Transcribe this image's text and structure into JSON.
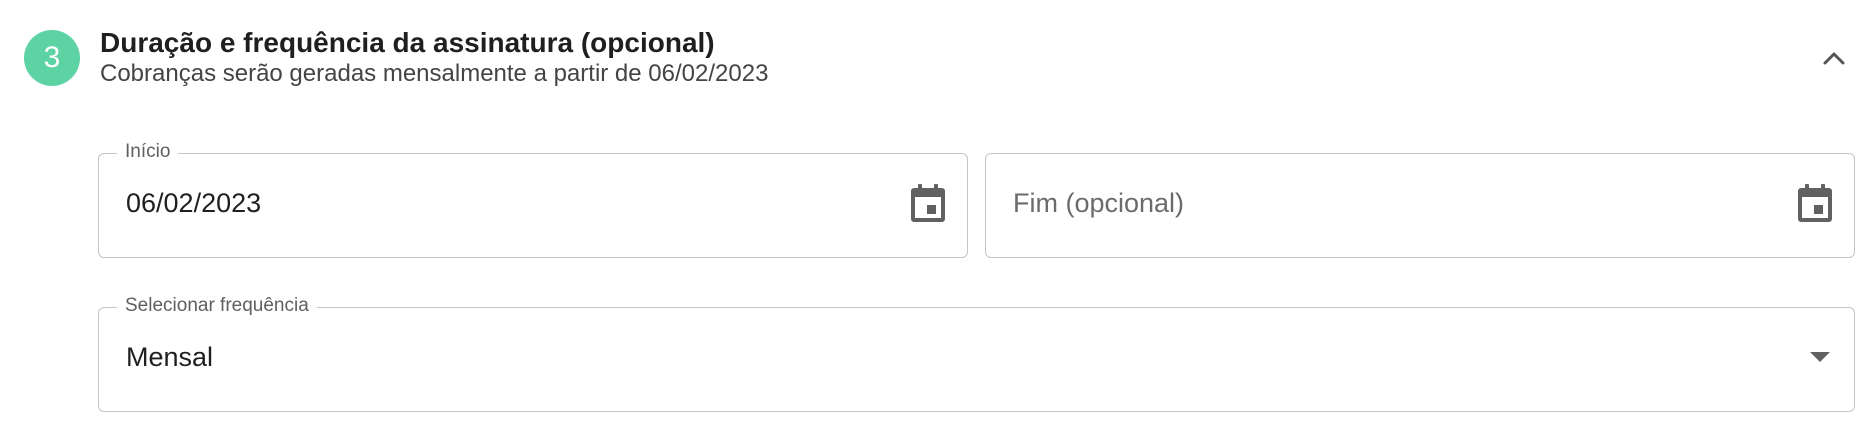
{
  "step": {
    "number": "3",
    "color": "#5dd3a4",
    "title": "Duração e frequência da assinatura (opcional)",
    "subtitle": "Cobranças serão geradas mensalmente a partir de 06/02/2023",
    "collapse_icon": "chevron-up-icon"
  },
  "start_field": {
    "label": "Início",
    "value": "06/02/2023",
    "icon": "calendar-icon"
  },
  "end_field": {
    "placeholder": "Fim (opcional)",
    "value": "",
    "icon": "calendar-icon"
  },
  "frequency_field": {
    "label": "Selecionar frequência",
    "selected": "Mensal",
    "icon": "dropdown-arrow-icon"
  },
  "colors": {
    "border": "#c4c4c4",
    "icon": "#616161",
    "accent": "#5dd3a4"
  }
}
